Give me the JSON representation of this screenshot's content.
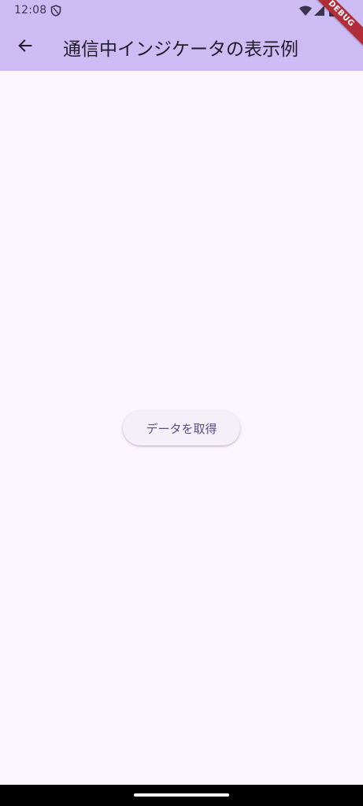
{
  "status_bar": {
    "time": "12:08",
    "icons": [
      "shield-icon",
      "wifi-icon",
      "signal-icon",
      "battery-icon"
    ]
  },
  "app_bar": {
    "title": "通信中インジケータの表示例",
    "back_icon": "arrow-back-icon"
  },
  "main": {
    "fetch_button_label": "データを取得"
  },
  "debug_banner": {
    "label": "DEBUG"
  },
  "colors": {
    "app_bar_background": "#cdbcf3",
    "page_background": "#fbf6fd",
    "button_background": "#f4eff8",
    "button_text": "#5a4e86",
    "debug_banner": "#b22d3a"
  }
}
